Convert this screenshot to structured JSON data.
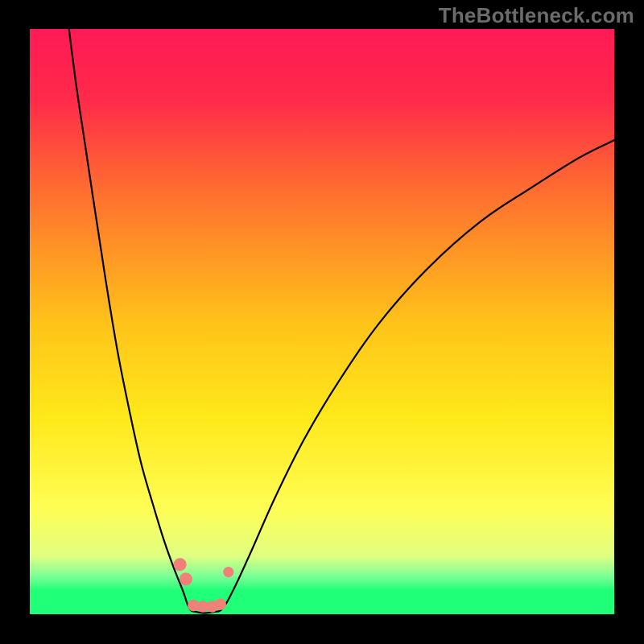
{
  "watermark": "TheBottleneck.com",
  "chart_data": {
    "type": "line",
    "title": "",
    "xlabel": "",
    "ylabel": "",
    "xlim": [
      0,
      100
    ],
    "ylim": [
      0,
      100
    ],
    "grid": false,
    "gradient_stops": [
      {
        "offset": 0.0,
        "color": "#ff1a55"
      },
      {
        "offset": 0.12,
        "color": "#ff2a4a"
      },
      {
        "offset": 0.28,
        "color": "#ff6f2f"
      },
      {
        "offset": 0.5,
        "color": "#ffc21a"
      },
      {
        "offset": 0.66,
        "color": "#ffe81a"
      },
      {
        "offset": 0.82,
        "color": "#fffd55"
      },
      {
        "offset": 0.9,
        "color": "#e0ff80"
      },
      {
        "offset": 0.935,
        "color": "#7dff98"
      },
      {
        "offset": 0.96,
        "color": "#1fff77"
      },
      {
        "offset": 1.0,
        "color": "#1fff77"
      }
    ],
    "series": [
      {
        "name": "left-branch",
        "x": [
          6.7,
          8.0,
          9.5,
          11.0,
          13.0,
          15.0,
          17.0,
          19.0,
          21.0,
          23.0,
          24.8,
          26.2,
          27.3
        ],
        "y": [
          100.0,
          90.0,
          80.0,
          70.0,
          57.0,
          45.0,
          35.0,
          26.0,
          19.0,
          12.5,
          7.5,
          4.0,
          1.0
        ]
      },
      {
        "name": "flat-bottom",
        "x": [
          27.3,
          28.5,
          30.0,
          31.5,
          33.0
        ],
        "y": [
          1.0,
          0.4,
          0.2,
          0.4,
          1.0
        ]
      },
      {
        "name": "right-branch",
        "x": [
          33.0,
          35.0,
          38.0,
          42.0,
          47.0,
          53.0,
          60.0,
          68.0,
          77.0,
          86.0,
          94.0,
          100.0
        ],
        "y": [
          1.0,
          4.5,
          11.0,
          20.0,
          30.0,
          40.0,
          50.0,
          59.0,
          67.0,
          73.0,
          78.0,
          81.0
        ]
      }
    ],
    "markers": [
      {
        "name": "left-cluster-upper",
        "x": 25.7,
        "y": 8.5,
        "r": 1.1
      },
      {
        "name": "left-cluster-lower",
        "x": 26.7,
        "y": 6.0,
        "r": 1.1
      },
      {
        "name": "right-small",
        "x": 34.0,
        "y": 7.2,
        "r": 0.9
      },
      {
        "name": "bottom-1",
        "x": 28.0,
        "y": 1.5,
        "r": 1.0
      },
      {
        "name": "bottom-2",
        "x": 29.6,
        "y": 1.3,
        "r": 1.0
      },
      {
        "name": "bottom-3",
        "x": 31.2,
        "y": 1.3,
        "r": 1.0
      },
      {
        "name": "bottom-4",
        "x": 32.6,
        "y": 1.7,
        "r": 1.0
      }
    ],
    "marker_color": "#f08078",
    "curve_color": "#000000"
  }
}
